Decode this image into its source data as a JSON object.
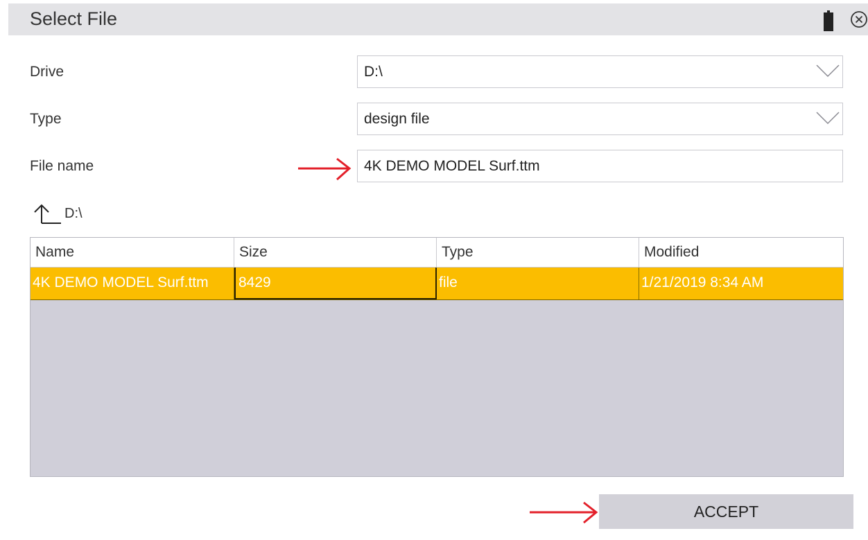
{
  "window": {
    "title": "Select File",
    "battery_icon": "battery-icon",
    "close_icon": "close-circle-icon"
  },
  "form": {
    "drive": {
      "label": "Drive",
      "value": "D:\\"
    },
    "type": {
      "label": "Type",
      "value": "design file"
    },
    "file_name": {
      "label": "File name",
      "value": "4K DEMO MODEL Surf.ttm"
    }
  },
  "path": {
    "up_icon": "folder-up-icon",
    "current": "D:\\"
  },
  "file_table": {
    "columns": [
      "Name",
      "Size",
      "Type",
      "Modified"
    ],
    "rows": [
      {
        "name": "4K DEMO MODEL Surf.ttm",
        "size": "8429",
        "type": "file",
        "modified": "1/21/2019 8:34 AM",
        "selected": true
      }
    ]
  },
  "actions": {
    "accept_label": "ACCEPT"
  },
  "colors": {
    "selected_row": "#fbbd00",
    "annotation_arrow": "#e3202a",
    "empty_list_bg": "#d0cfd9",
    "titlebar_bg": "#e3e3e6"
  }
}
